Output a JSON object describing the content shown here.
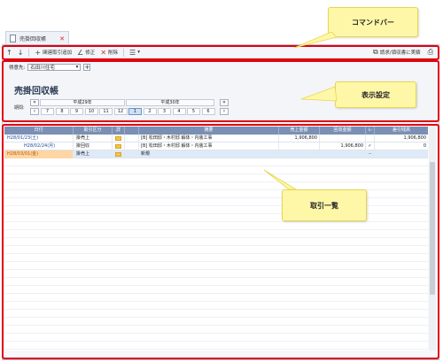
{
  "tab": {
    "title": "売掛回収帳"
  },
  "toolbar": {
    "related_add": "関連取引追加",
    "edit": "修正",
    "delete": "削除",
    "export": "請求/領収書に実績"
  },
  "settings": {
    "customer_label": "得意先:",
    "customer_value": "石田川住宅",
    "page_title": "売掛回収帳",
    "period_label": "期間:",
    "year_left": "平成29年",
    "year_right": "平成30年",
    "months": [
      "7",
      "8",
      "9",
      "10",
      "11",
      "12",
      "1",
      "2",
      "3",
      "4",
      "5",
      "6"
    ],
    "selected_month": "1"
  },
  "grid": {
    "headers": [
      "日付",
      "取引区分",
      "詳",
      "摘要",
      "売上金額",
      "回収金額",
      "レ",
      "差引残高"
    ],
    "rows": [
      {
        "date": "H28/01/23(土)",
        "type": "掛売上",
        "desc": "[B] 松田邸・木村邸 解体・内装工事",
        "sales": "1,906,800",
        "collect": "",
        "check": "",
        "balance": "1,906,800"
      },
      {
        "date": "H28/02/24(月)",
        "type": "掛回収",
        "desc": "[B] 松田邸・木村邸 解体・内装工事",
        "sales": "",
        "collect": "1,906,800",
        "check": "✓",
        "balance": "0"
      },
      {
        "date": "H28/03/01(金)",
        "type": "掛売上",
        "desc": "新規",
        "sales": "",
        "collect": "",
        "check": "",
        "balance": ""
      }
    ]
  },
  "callouts": {
    "command_bar": "コマンドバー",
    "display_settings": "表示設定",
    "transaction_list": "取引一覧"
  },
  "colors": {
    "highlight": "#e0000f",
    "callout_bg": "#fff7a8",
    "header_bg": "#7a8fb3"
  }
}
